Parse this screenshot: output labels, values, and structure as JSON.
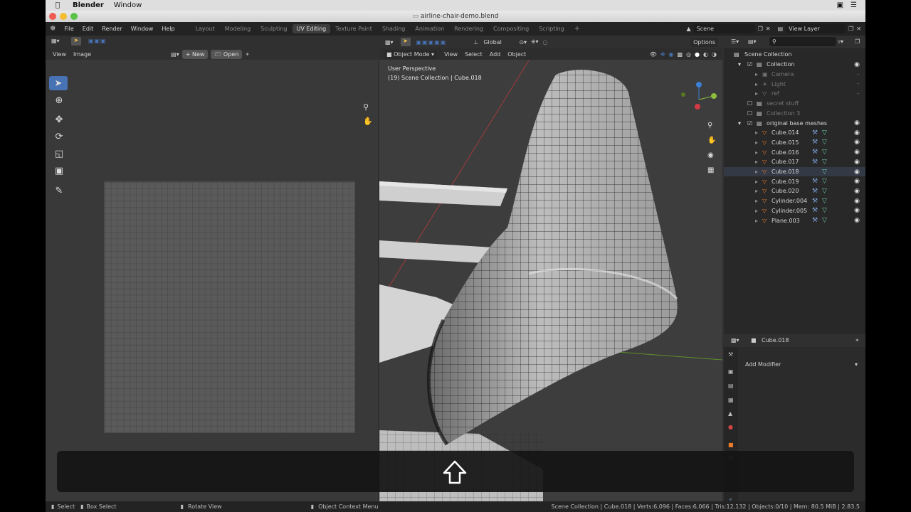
{
  "menubar": {
    "app_name": "Blender",
    "menu_window": "Window"
  },
  "titlebar": {
    "filename": "airline-chair-demo.blend"
  },
  "topbar": {
    "menus": [
      "File",
      "Edit",
      "Render",
      "Window",
      "Help"
    ],
    "workspaces": [
      "Layout",
      "Modeling",
      "Sculpting",
      "UV Editing",
      "Texture Paint",
      "Shading",
      "Animation",
      "Rendering",
      "Compositing",
      "Scripting"
    ],
    "active_workspace": "UV Editing",
    "scene_value": "Scene",
    "view_layer_value": "View Layer"
  },
  "uv_editor": {
    "menu_view": "View",
    "menu_image": "Image",
    "new_label": "New",
    "open_label": "Open"
  },
  "viewport": {
    "mode": "Object Mode",
    "menus": [
      "View",
      "Select",
      "Add",
      "Object"
    ],
    "orientation": "Global",
    "options_label": "Options",
    "perspective": "User Perspective",
    "collection_info": "(19) Scene Collection | Cube.018"
  },
  "outliner": {
    "root": "Scene Collection",
    "items": [
      {
        "label": "Collection",
        "dim": false
      },
      {
        "label": "Camera",
        "dim": true
      },
      {
        "label": "Light",
        "dim": true
      },
      {
        "label": "ref",
        "dim": true
      },
      {
        "label": "secret stuff",
        "dim": true
      },
      {
        "label": "Collection 3",
        "dim": true
      },
      {
        "label": "original base meshes",
        "dim": false
      },
      {
        "label": "Cube.014",
        "dim": false
      },
      {
        "label": "Cube.015",
        "dim": false
      },
      {
        "label": "Cube.016",
        "dim": false
      },
      {
        "label": "Cube.017",
        "dim": false
      },
      {
        "label": "Cube.018",
        "dim": false
      },
      {
        "label": "Cube.019",
        "dim": false
      },
      {
        "label": "Cube.020",
        "dim": false
      },
      {
        "label": "Cylinder.004",
        "dim": false
      },
      {
        "label": "Cylinder.005",
        "dim": false
      },
      {
        "label": "Plane.003",
        "dim": false
      }
    ]
  },
  "properties": {
    "object_name": "Cube.018",
    "add_modifier": "Add Modifier"
  },
  "statusbar": {
    "select": "Select",
    "box_select": "Box Select",
    "rotate_view": "Rotate View",
    "context_menu": "Object Context Menu",
    "stats": "Scene Collection | Cube.018 | Verts:6,096 | Faces:6,066 | Tris:12,132 | Objects:0/10 | Mem: 80.5 MiB | 2.83.5"
  },
  "colors": {
    "accent": "#4772b3",
    "object_orange": "#e97b2e",
    "window_bg": "#303030"
  }
}
